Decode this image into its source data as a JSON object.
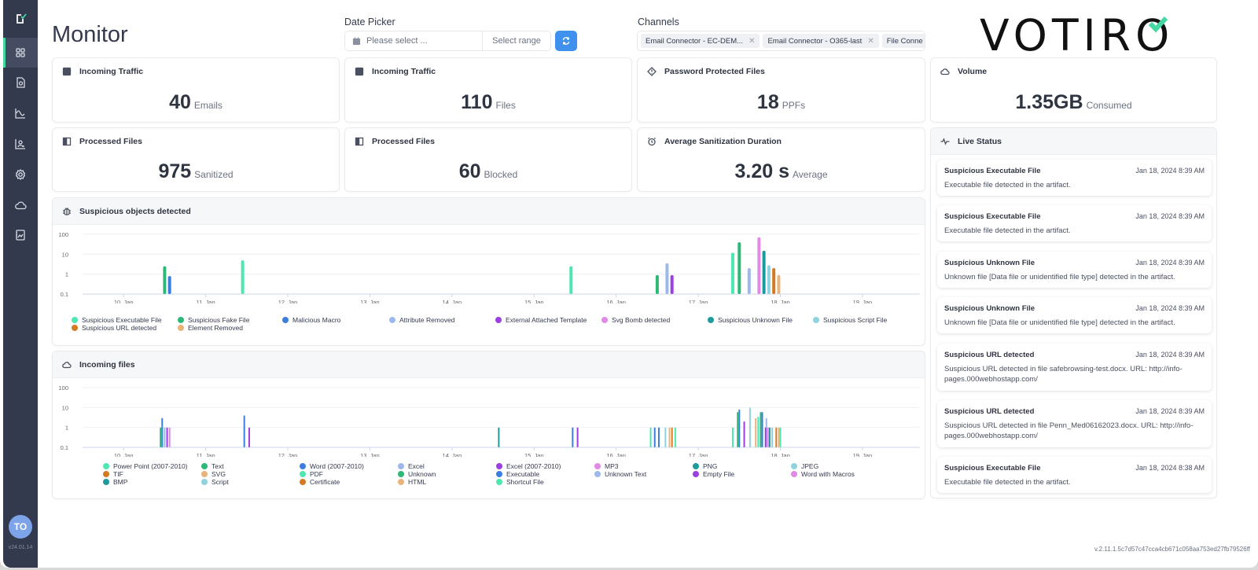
{
  "app": {
    "name": "Votiro",
    "version": "v24.01.14",
    "build": "v.2.11.1.5c7d57c47cca4cb671c058aa753ed27fb79526ff"
  },
  "page": {
    "title": "Monitor"
  },
  "sidebar": {
    "items": [
      {
        "name": "dashboard",
        "icon": "grid-icon",
        "active": true
      },
      {
        "name": "files",
        "icon": "file-scan-icon",
        "active": false
      },
      {
        "name": "analytics",
        "icon": "line-chart-icon",
        "active": false
      },
      {
        "name": "reports",
        "icon": "bar-chart-user-icon",
        "active": false
      },
      {
        "name": "settings",
        "icon": "gear-icon",
        "active": false
      },
      {
        "name": "cloud",
        "icon": "cloud-icon",
        "active": false
      },
      {
        "name": "documents",
        "icon": "image-file-icon",
        "active": false
      }
    ],
    "avatar_initials": "TO"
  },
  "date_picker": {
    "label": "Date Picker",
    "placeholder": "Please select ...",
    "range_label": "Select range",
    "refresh_icon": "refresh-icon"
  },
  "channels": {
    "label": "Channels",
    "chips": [
      "Email Connector - EC-DEM...",
      "Email Connector - O365-last",
      "File Conne"
    ]
  },
  "logo": {
    "text": "VOTIRO",
    "accent": "#44d7a1"
  },
  "stats": [
    {
      "title": "Incoming Traffic",
      "value": "40",
      "unit": "Emails",
      "icon": "inbox-icon"
    },
    {
      "title": "Incoming Traffic",
      "value": "110",
      "unit": "Files",
      "icon": "inbox-icon"
    },
    {
      "title": "Password Protected Files",
      "value": "18",
      "unit": "PPFs",
      "icon": "warning-diamond-icon"
    },
    {
      "title": "Volume",
      "value": "1.35GB",
      "unit": "Consumed",
      "icon": "cloud-icon"
    },
    {
      "title": "Processed Files",
      "value": "975",
      "unit": "Sanitized",
      "icon": "book-icon"
    },
    {
      "title": "Processed Files",
      "value": "60",
      "unit": "Blocked",
      "icon": "book-icon"
    },
    {
      "title": "Average Sanitization Duration",
      "value": "3.20 s",
      "unit": "Average",
      "icon": "alarm-clock-icon"
    }
  ],
  "live_status": {
    "title": "Live Status",
    "items": [
      {
        "title": "Suspicious Executable File",
        "time": "Jan 18, 2024 8:39 AM",
        "desc": "Executable file detected in the artifact."
      },
      {
        "title": "Suspicious Executable File",
        "time": "Jan 18, 2024 8:39 AM",
        "desc": "Executable file detected in the artifact."
      },
      {
        "title": "Suspicious Unknown File",
        "time": "Jan 18, 2024 8:39 AM",
        "desc": "Unknown file [Data file or unidentified file type] detected in the artifact."
      },
      {
        "title": "Suspicious Unknown File",
        "time": "Jan 18, 2024 8:39 AM",
        "desc": "Unknown file [Data file or unidentified file type] detected in the artifact."
      },
      {
        "title": "Suspicious URL detected",
        "time": "Jan 18, 2024 8:39 AM",
        "desc": "Suspicious URL detected in file safebrowsing-test.docx. URL: http://info-pages.000webhostapp.com/"
      },
      {
        "title": "Suspicious URL detected",
        "time": "Jan 18, 2024 8:39 AM",
        "desc": "Suspicious URL detected in file Penn_Med06162023.docx. URL: http://info-pages.000webhostapp.com/"
      },
      {
        "title": "Suspicious Executable File",
        "time": "Jan 18, 2024 8:38 AM",
        "desc": "Executable file detected in the artifact."
      }
    ]
  },
  "chart_data": [
    {
      "type": "bar",
      "title": "Suspicious objects detected",
      "yscale": "log",
      "ylim": [
        0.1,
        100
      ],
      "yticks": [
        "100",
        "10",
        "1",
        "0.1"
      ],
      "xticks": [
        "10. Jan",
        "11. Jan",
        "12. Jan",
        "13. Jan",
        "14. Jan",
        "15. Jan",
        "16. Jan",
        "17. Jan",
        "18. Jan",
        "19. Jan"
      ],
      "xrange_days": [
        9.5,
        19.7
      ],
      "series": [
        {
          "name": "Suspicious Executable File",
          "color": "#4de8b0",
          "points": [
            [
              11.45,
              5
            ],
            [
              15.45,
              2.5
            ],
            [
              17.42,
              12
            ]
          ]
        },
        {
          "name": "Suspicious Fake File",
          "color": "#2db877",
          "points": [
            [
              10.5,
              2.5
            ],
            [
              16.5,
              0.9
            ],
            [
              17.5,
              40
            ]
          ]
        },
        {
          "name": "Malicious Macro",
          "color": "#3c7de0",
          "points": [
            [
              10.56,
              0.8
            ]
          ]
        },
        {
          "name": "Attribute Removed",
          "color": "#9db8ec",
          "points": [
            [
              16.62,
              3.5
            ],
            [
              17.62,
              2
            ]
          ]
        },
        {
          "name": "External Attached Template",
          "color": "#9b3fe0",
          "points": [
            [
              16.68,
              0.9
            ]
          ]
        },
        {
          "name": "Svg Bomb detected",
          "color": "#e08ae6",
          "points": [
            [
              17.74,
              70
            ]
          ]
        },
        {
          "name": "Suspicious Unknown File",
          "color": "#1f9a9a",
          "points": [
            [
              17.8,
              15
            ]
          ]
        },
        {
          "name": "Suspicious Script File",
          "color": "#8fd3e0",
          "points": [
            [
              17.86,
              2.8
            ]
          ]
        },
        {
          "name": "Suspicious URL detected",
          "color": "#d47a22",
          "points": [
            [
              17.92,
              2
            ]
          ]
        },
        {
          "name": "Element Removed",
          "color": "#eab37a",
          "points": [
            [
              17.98,
              0.9
            ]
          ]
        }
      ]
    },
    {
      "type": "bar",
      "title": "Incoming files",
      "yscale": "log",
      "ylim": [
        0.1,
        100
      ],
      "yticks": [
        "100",
        "10",
        "1",
        "0.1"
      ],
      "xticks": [
        "10. Jan",
        "11. Jan",
        "12. Jan",
        "13. Jan",
        "14. Jan",
        "15. Jan",
        "16. Jan",
        "17. Jan",
        "18. Jan",
        "19. Jan"
      ],
      "xrange_days": [
        9.5,
        19.7
      ],
      "series": [
        {
          "name": "Power Point (2007-2010)",
          "color": "#4de8b0",
          "points": []
        },
        {
          "name": "Text",
          "color": "#2db877",
          "points": [
            [
              10.45,
              1
            ],
            [
              17.48,
              6
            ]
          ]
        },
        {
          "name": "Word (2007-2010)",
          "color": "#3c7de0",
          "points": [
            [
              10.47,
              3
            ],
            [
              11.47,
              4
            ],
            [
              15.47,
              1
            ],
            [
              16.47,
              1
            ],
            [
              17.5,
              8
            ],
            [
              17.78,
              6
            ]
          ]
        },
        {
          "name": "Excel",
          "color": "#9db8ec",
          "points": [
            [
              10.5,
              1
            ],
            [
              17.83,
              3
            ]
          ]
        },
        {
          "name": "TIF",
          "color": "#d47a22",
          "points": []
        },
        {
          "name": "SVG",
          "color": "#eab37a",
          "points": [
            [
              16.65,
              1
            ],
            [
              17.7,
              3
            ]
          ]
        },
        {
          "name": "BMP",
          "color": "#1f9a9a",
          "points": [
            [
              14.57,
              1
            ],
            [
              17.87,
              1
            ]
          ]
        },
        {
          "name": "Script",
          "color": "#8fd3e0",
          "points": [
            [
              16.6,
              1
            ],
            [
              17.63,
              10
            ],
            [
              17.9,
              1
            ]
          ]
        },
        {
          "name": "PDF",
          "color": "#4de8b0",
          "points": [
            [
              17.73,
              3.5
            ]
          ]
        },
        {
          "name": "Unknown",
          "color": "#2db877",
          "points": [
            [
              17.76,
              6
            ]
          ]
        },
        {
          "name": "Certificate",
          "color": "#d47a22",
          "points": [
            [
              16.68,
              1
            ],
            [
              17.95,
              1
            ]
          ]
        },
        {
          "name": "HTML",
          "color": "#eab37a",
          "points": [
            [
              17.98,
              1
            ]
          ]
        },
        {
          "name": "Excel (2007-2010)",
          "color": "#9b3fe0",
          "points": [
            [
              10.53,
              1
            ],
            [
              11.53,
              1
            ],
            [
              15.53,
              1
            ],
            [
              17.56,
              2
            ],
            [
              17.82,
              1
            ]
          ]
        },
        {
          "name": "Executable",
          "color": "#3c7de0",
          "points": [
            [
              16.52,
              1
            ]
          ]
        },
        {
          "name": "Shortcut File",
          "color": "#4de8b0",
          "points": [
            [
              16.42,
              1
            ],
            [
              16.72,
              1
            ],
            [
              17.42,
              1
            ],
            [
              18.0,
              1
            ]
          ]
        },
        {
          "name": "MP3",
          "color": "#e08ae6",
          "points": [
            [
              10.56,
              1
            ]
          ]
        },
        {
          "name": "Unknown Text",
          "color": "#9db8ec",
          "points": []
        },
        {
          "name": "PNG",
          "color": "#1f9a9a",
          "points": []
        },
        {
          "name": "Empty File",
          "color": "#9b3fe0",
          "points": []
        },
        {
          "name": "JPEG",
          "color": "#8fd3e0",
          "points": []
        },
        {
          "name": "Word with Macros",
          "color": "#e08ae6",
          "points": [
            [
              17.85,
              1
            ]
          ]
        }
      ]
    }
  ]
}
